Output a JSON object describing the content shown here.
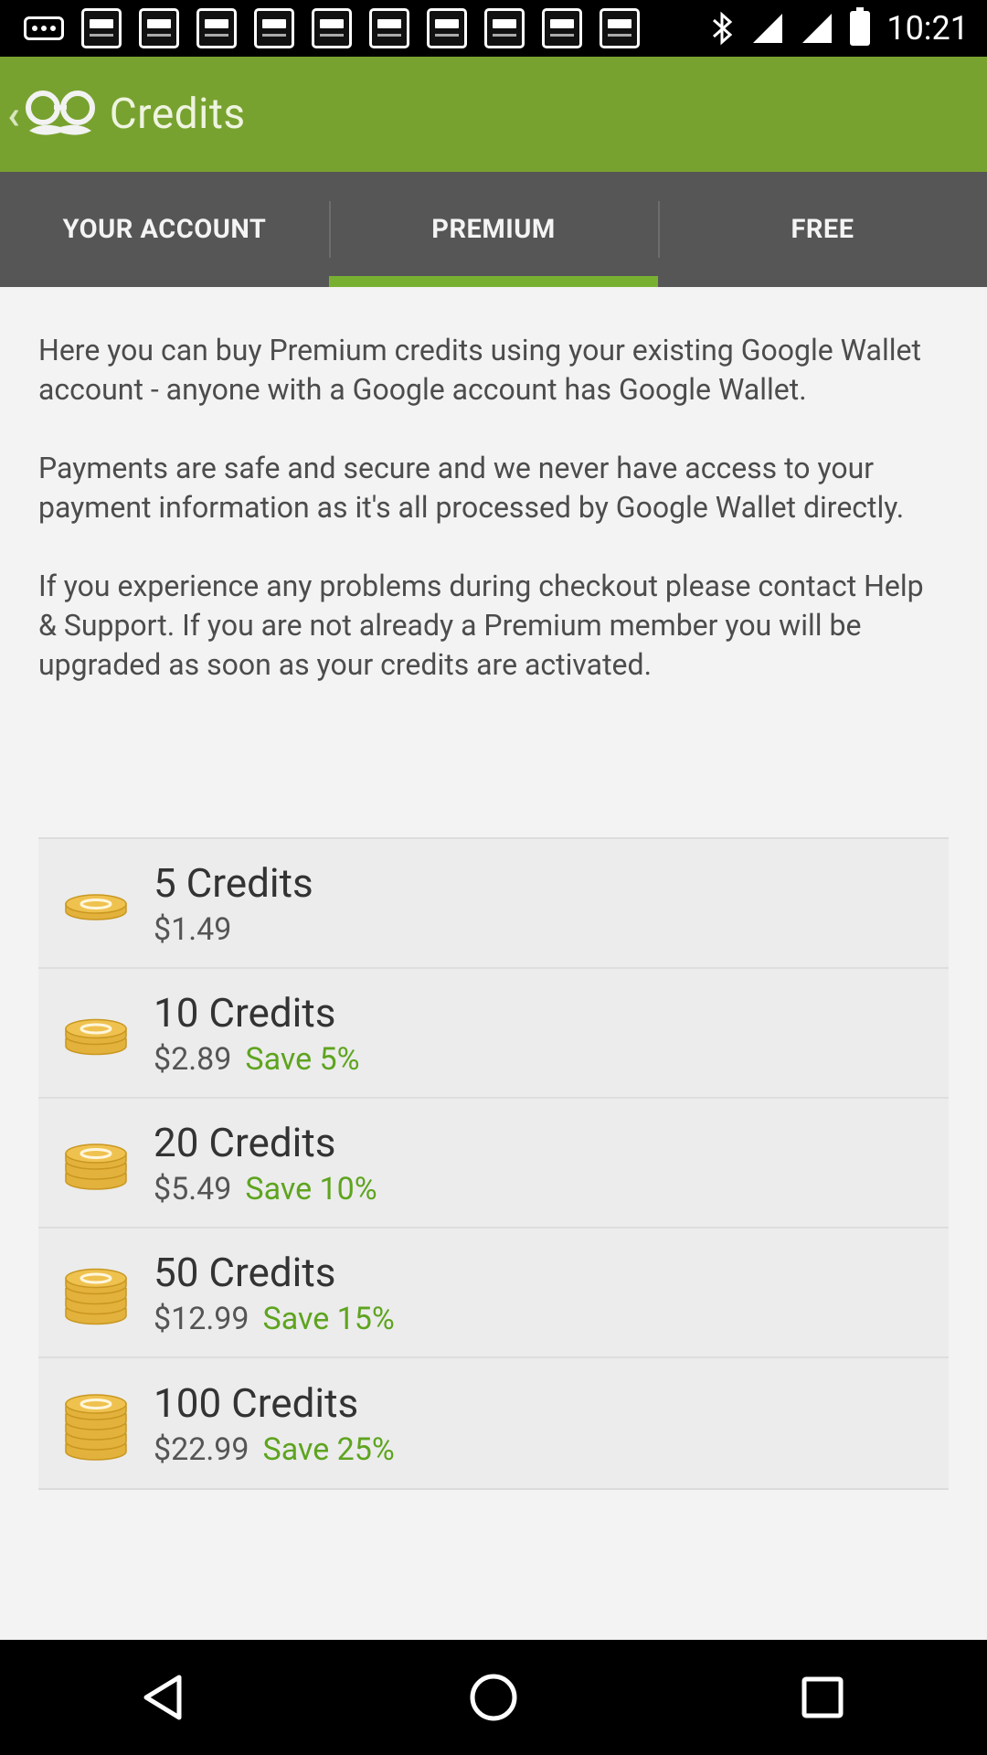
{
  "status_bar": {
    "time": "10:21",
    "notification_count": 10
  },
  "app_bar": {
    "title": "Credits"
  },
  "tabs": [
    {
      "label": "YOUR ACCOUNT",
      "active": false
    },
    {
      "label": "PREMIUM",
      "active": true
    },
    {
      "label": "FREE",
      "active": false
    }
  ],
  "intro": {
    "paragraphs": [
      "Here you can buy Premium credits using your existing Google Wallet account - anyone with a Google account has Google Wallet.",
      "Payments are safe and secure and we never have access to your payment information as it's all processed by Google Wallet directly.",
      "If you experience any problems during checkout please contact Help & Support. If you are not already a Premium member you will be upgraded as soon as your credits are activated."
    ]
  },
  "credits": [
    {
      "name": "5 Credits",
      "price": "$1.49",
      "save": "",
      "coins": 1
    },
    {
      "name": "10 Credits",
      "price": "$2.89",
      "save": "Save 5%",
      "coins": 2
    },
    {
      "name": "20 Credits",
      "price": "$5.49",
      "save": "Save 10%",
      "coins": 3
    },
    {
      "name": "50 Credits",
      "price": "$12.99",
      "save": "Save 15%",
      "coins": 4
    },
    {
      "name": "100 Credits",
      "price": "$22.99",
      "save": "Save 25%",
      "coins": 5
    }
  ],
  "colors": {
    "app_bar": "#78a22f",
    "tab_bar": "#565656",
    "tab_indicator": "#78b132",
    "save_text": "#5ea41f",
    "coin": "#e3b23c"
  }
}
